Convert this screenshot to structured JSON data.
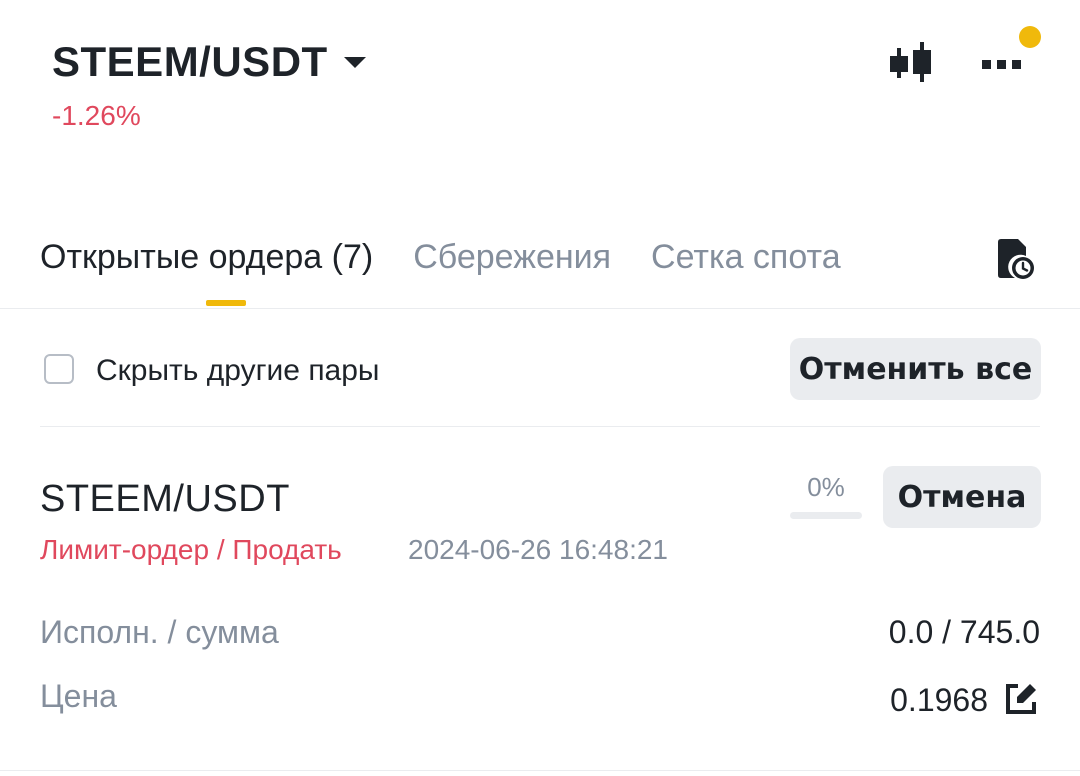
{
  "header": {
    "pair": "STEEM/USDT",
    "change": "-1.26%",
    "icons": {
      "chart": "candlestick-icon",
      "more": "more-icon"
    },
    "notification": true
  },
  "tabs": [
    {
      "label": "Открытые ордера (7)",
      "active": true
    },
    {
      "label": "Сбережения",
      "active": false
    },
    {
      "label": "Сетка спота",
      "active": false
    }
  ],
  "history_icon": "order-history-icon",
  "filter": {
    "hide_other_pairs_label": "Скрыть другие пары",
    "hide_other_pairs_checked": false,
    "cancel_all_label": "Отменить все"
  },
  "order": {
    "symbol": "STEEM/USDT",
    "type": "Лимит-ордер / Продать",
    "time": "2024-06-26 16:48:21",
    "progress_label": "0%",
    "progress": 0,
    "cancel_label": "Отмена",
    "filled_label": "Исполн. / сумма",
    "filled_value": "0.0 / 745.0",
    "price_label": "Цена",
    "price_value": "0.1968"
  },
  "colors": {
    "accent": "#f0b90b",
    "sell": "#e0485d",
    "text": "#1e2329",
    "muted": "#848e9c",
    "button_bg": "#eaecef"
  }
}
